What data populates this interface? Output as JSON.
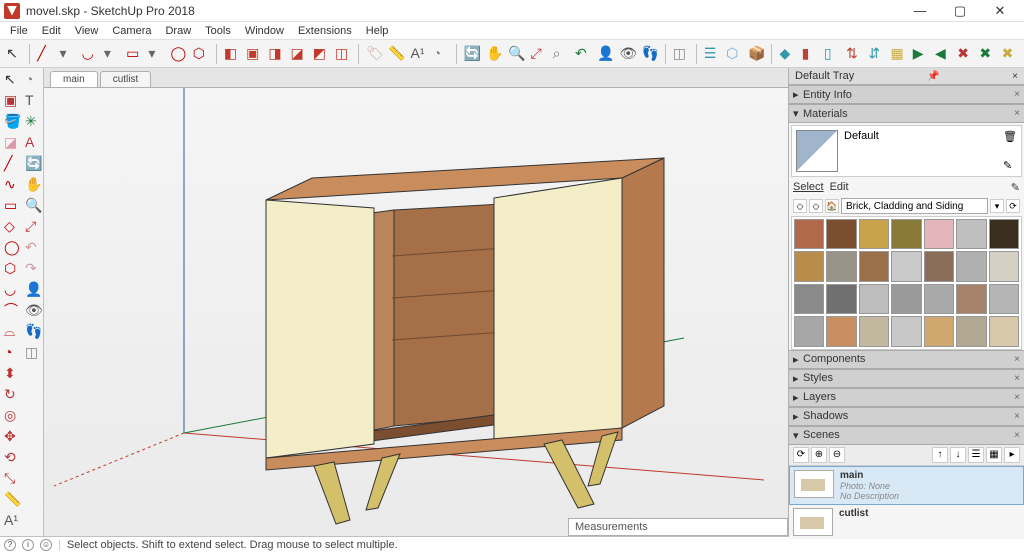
{
  "title": "movel.skp - SketchUp Pro 2018",
  "menu": [
    "File",
    "Edit",
    "View",
    "Camera",
    "Draw",
    "Tools",
    "Window",
    "Extensions",
    "Help"
  ],
  "scene_tabs": [
    "main",
    "cutlist"
  ],
  "active_scene_tab": "main",
  "tray": {
    "header": "Default Tray",
    "panels": {
      "entity_info": {
        "label": "Entity Info",
        "open": false
      },
      "materials": {
        "label": "Materials",
        "open": true,
        "current": "Default",
        "tabs": [
          "Select",
          "Edit"
        ],
        "collection": "Brick, Cladding and Siding",
        "swatches": [
          "#b0694a",
          "#7a4e2e",
          "#c9a24c",
          "#8a7a3a",
          "#e2b6bb",
          "#bfbfbf",
          "#3a2f1e",
          "#b88c4a",
          "#9a9488",
          "#9a6f4a",
          "#c9c9c9",
          "#8a6e5a",
          "#b0b0b0",
          "#d6d0c4",
          "#8a8a8a",
          "#707070",
          "#bdbdbd",
          "#9a9a9a",
          "#a9a9a9",
          "#a5836a",
          "#b5b5b5",
          "#a7a7a7",
          "#c89060",
          "#c2b8a0",
          "#c8c8c8",
          "#cfa870",
          "#b0a890",
          "#d6c8a8"
        ]
      },
      "components": {
        "label": "Components",
        "open": false
      },
      "styles": {
        "label": "Styles",
        "open": false
      },
      "layers": {
        "label": "Layers",
        "open": false
      },
      "shadows": {
        "label": "Shadows",
        "open": false
      },
      "scenes": {
        "label": "Scenes",
        "open": true,
        "items": [
          {
            "name": "main",
            "photo": "Photo: None",
            "desc": "No Description",
            "active": true
          },
          {
            "name": "cutlist",
            "photo": "",
            "desc": "",
            "active": false
          }
        ]
      }
    }
  },
  "measurements_label": "Measurements",
  "status_hint": "Select objects. Shift to extend select. Drag mouse to select multiple.",
  "window_buttons": {
    "min": "—",
    "max": "▢",
    "close": "✕"
  },
  "top_toolbar": [
    {
      "name": "select-pointer-icon",
      "glyph": "↖",
      "c": "#333"
    },
    {
      "sep": true
    },
    {
      "name": "line-tool-icon",
      "glyph": "╱",
      "c": "#b00"
    },
    {
      "name": "line-dropdown-icon",
      "glyph": "▾",
      "c": "#666"
    },
    {
      "name": "arc-tool-icon",
      "glyph": "◡",
      "c": "#b00"
    },
    {
      "name": "arc-dropdown-icon",
      "glyph": "▾",
      "c": "#666"
    },
    {
      "name": "rectangle-tool-icon",
      "glyph": "▭",
      "c": "#b00"
    },
    {
      "name": "rect-dropdown-icon",
      "glyph": "▾",
      "c": "#666"
    },
    {
      "name": "circle-tool-icon",
      "glyph": "◯",
      "c": "#b00"
    },
    {
      "name": "polygon-tool-icon",
      "glyph": "⬡",
      "c": "#b00"
    },
    {
      "sep": true
    },
    {
      "name": "iso-view-icon",
      "glyph": "◧",
      "c": "#c0392b"
    },
    {
      "name": "top-view-icon",
      "glyph": "▣",
      "c": "#c0392b"
    },
    {
      "name": "front-view-icon",
      "glyph": "◨",
      "c": "#c0392b"
    },
    {
      "name": "right-view-icon",
      "glyph": "◪",
      "c": "#c0392b"
    },
    {
      "name": "back-view-icon",
      "glyph": "◩",
      "c": "#c0392b"
    },
    {
      "name": "left-view-icon",
      "glyph": "◫",
      "c": "#c0392b"
    },
    {
      "sep": true
    },
    {
      "name": "tag-tool-icon",
      "glyph": "🏷",
      "c": "#caa"
    },
    {
      "name": "tape-measure-icon",
      "glyph": "📏",
      "c": "#888"
    },
    {
      "name": "dimension-icon",
      "glyph": "A¹",
      "c": "#555"
    },
    {
      "name": "protractor-icon",
      "glyph": "◔",
      "c": "#888"
    },
    {
      "sep": true
    },
    {
      "name": "orbit-icon",
      "glyph": "🔄",
      "c": "#1a7a3a"
    },
    {
      "name": "pan-icon",
      "glyph": "✋",
      "c": "#c99"
    },
    {
      "name": "zoom-icon",
      "glyph": "🔍",
      "c": "#777"
    },
    {
      "name": "zoom-extents-icon",
      "glyph": "⤢",
      "c": "#b33"
    },
    {
      "name": "zoom-window-icon",
      "glyph": "⌕",
      "c": "#777"
    },
    {
      "name": "previous-icon",
      "glyph": "↶",
      "c": "#1a7a3a"
    },
    {
      "name": "position-camera-icon",
      "glyph": "👤",
      "c": "#b33"
    },
    {
      "name": "look-around-icon",
      "glyph": "👁",
      "c": "#555"
    },
    {
      "name": "walk-icon",
      "glyph": "👣",
      "c": "#b33"
    },
    {
      "sep": true
    },
    {
      "name": "section-plane-icon",
      "glyph": "◫",
      "c": "#888"
    },
    {
      "sep": true
    },
    {
      "name": "outliner-icon",
      "glyph": "☰",
      "c": "#39a"
    },
    {
      "name": "geo-locate-icon",
      "glyph": "⬡",
      "c": "#7ac"
    },
    {
      "name": "3d-warehouse-icon",
      "glyph": "📦",
      "c": "#c99"
    },
    {
      "sep": true
    },
    {
      "name": "solid-union-icon",
      "glyph": "◆",
      "c": "#39a"
    },
    {
      "name": "solid-subtract-icon",
      "glyph": "▮",
      "c": "#b43"
    },
    {
      "name": "solid-trim-icon",
      "glyph": "▯",
      "c": "#39a"
    },
    {
      "name": "solid-intersect-icon",
      "glyph": "⇅",
      "c": "#b43"
    },
    {
      "name": "solid-split-icon",
      "glyph": "⇵",
      "c": "#39a"
    },
    {
      "name": "solid-outer-icon",
      "glyph": "▦",
      "c": "#ca4"
    },
    {
      "name": "flip-along-icon",
      "glyph": "▶",
      "c": "#1a7a3a"
    },
    {
      "name": "flip-along2-icon",
      "glyph": "◀",
      "c": "#1a7a3a"
    },
    {
      "name": "axis-x-icon",
      "glyph": "✖",
      "c": "#b33"
    },
    {
      "name": "axis-y-icon",
      "glyph": "✖",
      "c": "#1a7a3a"
    },
    {
      "name": "axis-z-icon",
      "glyph": "✖",
      "c": "#ca4"
    }
  ],
  "left_toolbar": [
    {
      "name": "select-icon",
      "glyph": "↖",
      "c": "#333"
    },
    {
      "name": "make-component-icon",
      "glyph": "▣",
      "c": "#b33"
    },
    {
      "name": "paint-bucket-icon",
      "glyph": "🪣",
      "c": "#c77"
    },
    {
      "name": "eraser-icon",
      "glyph": "◪",
      "c": "#d9a"
    },
    {
      "name": "line-icon",
      "glyph": "╱",
      "c": "#b00"
    },
    {
      "name": "freehand-icon",
      "glyph": "∿",
      "c": "#b00"
    },
    {
      "name": "rectangle-icon",
      "glyph": "▭",
      "c": "#b00"
    },
    {
      "name": "rotated-rect-icon",
      "glyph": "◇",
      "c": "#b00"
    },
    {
      "name": "circle-icon",
      "glyph": "◯",
      "c": "#b00"
    },
    {
      "name": "polygon-icon",
      "glyph": "⬡",
      "c": "#b00"
    },
    {
      "name": "arc-icon",
      "glyph": "◡",
      "c": "#b00"
    },
    {
      "name": "2pt-arc-icon",
      "glyph": "⌒",
      "c": "#b00"
    },
    {
      "name": "3pt-arc-icon",
      "glyph": "⌓",
      "c": "#b00"
    },
    {
      "name": "pie-icon",
      "glyph": "◔",
      "c": "#b00"
    },
    {
      "name": "pushpull-icon",
      "glyph": "⬍",
      "c": "#b33"
    },
    {
      "name": "follow-me-icon",
      "glyph": "↻",
      "c": "#b33"
    },
    {
      "name": "offset-icon",
      "glyph": "◎",
      "c": "#b33"
    },
    {
      "name": "move-icon",
      "glyph": "✥",
      "c": "#b33"
    },
    {
      "name": "rotate-icon",
      "glyph": "⟲",
      "c": "#b33"
    },
    {
      "name": "scale-icon",
      "glyph": "⤡",
      "c": "#b33"
    },
    {
      "name": "tape-icon",
      "glyph": "📏",
      "c": "#888"
    },
    {
      "name": "dimension-icon",
      "glyph": "A¹",
      "c": "#555"
    },
    {
      "name": "protractor-icon",
      "glyph": "◔",
      "c": "#888"
    },
    {
      "name": "text-icon",
      "glyph": "T",
      "c": "#555"
    },
    {
      "name": "axes-icon",
      "glyph": "✳",
      "c": "#1a7a3a"
    },
    {
      "name": "3d-text-icon",
      "glyph": "A",
      "c": "#b33"
    },
    {
      "name": "orbit-icon",
      "glyph": "🔄",
      "c": "#1a7a3a"
    },
    {
      "name": "pan-icon",
      "glyph": "✋",
      "c": "#c99"
    },
    {
      "name": "zoom-icon",
      "glyph": "🔍",
      "c": "#777"
    },
    {
      "name": "zoom-extents-icon",
      "glyph": "⤢",
      "c": "#b33"
    },
    {
      "name": "prev-view-icon",
      "glyph": "↶",
      "c": "#c99"
    },
    {
      "name": "next-view-icon",
      "glyph": "↷",
      "c": "#c99"
    },
    {
      "name": "position-camera-icon",
      "glyph": "👤",
      "c": "#b33"
    },
    {
      "name": "look-around-icon",
      "glyph": "👁",
      "c": "#555"
    },
    {
      "name": "walk-icon",
      "glyph": "👣",
      "c": "#b33"
    },
    {
      "name": "section-icon",
      "glyph": "◫",
      "c": "#888"
    }
  ]
}
